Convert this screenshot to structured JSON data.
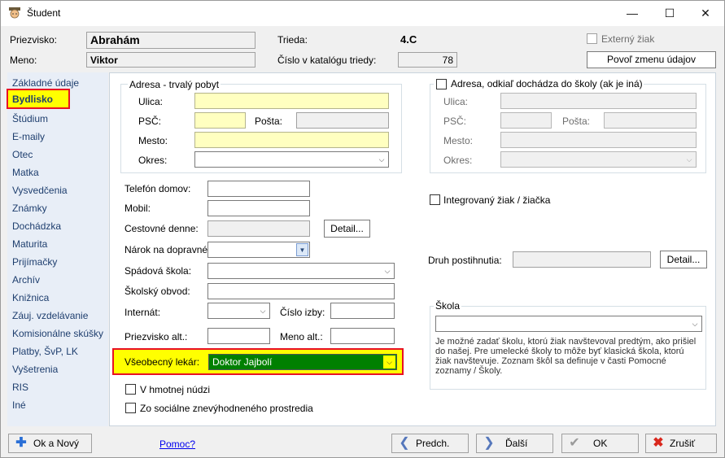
{
  "window": {
    "title": "Študent",
    "minimize": "—",
    "maximize": "☐",
    "close": "✕"
  },
  "header": {
    "surname_label": "Priezvisko:",
    "surname": "Abrahám",
    "name_label": "Meno:",
    "name": "Viktor",
    "class_label": "Trieda:",
    "class_value": "4.C",
    "catalog_label": "Číslo v katalógu triedy:",
    "catalog_value": "78",
    "external_label": "Externý žiak",
    "allow_change_label": "Povoľ zmenu údajov"
  },
  "sidebar": {
    "items": [
      {
        "label": "Základné údaje"
      },
      {
        "label": "Bydlisko",
        "selected": true
      },
      {
        "label": "Štúdium"
      },
      {
        "label": "E-maily"
      },
      {
        "label": "Otec"
      },
      {
        "label": "Matka"
      },
      {
        "label": "Vysvedčenia"
      },
      {
        "label": "Známky"
      },
      {
        "label": "Dochádzka"
      },
      {
        "label": "Maturita"
      },
      {
        "label": "Prijímačky"
      },
      {
        "label": "Archív"
      },
      {
        "label": "Knižnica"
      },
      {
        "label": "Záuj. vzdelávanie"
      },
      {
        "label": "Komisionálne skúšky"
      },
      {
        "label": "Platby, ŠvP, LK"
      },
      {
        "label": "Vyšetrenia"
      },
      {
        "label": "RIS"
      },
      {
        "label": "Iné"
      }
    ]
  },
  "address": {
    "title": "Adresa - trvalý pobyt",
    "street_label": "Ulica:",
    "street": "",
    "zip_label": "PSČ:",
    "zip": "",
    "post_label": "Pošta:",
    "post": "",
    "city_label": "Mesto:",
    "city": "",
    "district_label": "Okres:",
    "district": ""
  },
  "address2": {
    "title": "Adresa, odkiaľ dochádza do školy (ak je iná)",
    "street_label": "Ulica:",
    "zip_label": "PSČ:",
    "post_label": "Pošta:",
    "city_label": "Mesto:",
    "district_label": "Okres:"
  },
  "contact": {
    "home_phone_label": "Telefón domov:",
    "mobile_label": "Mobil:",
    "travel_label": "Cestovné denne:",
    "detail_label": "Detail...",
    "transport_label": "Nárok na dopravné:",
    "catchment_label": "Spádová škola:",
    "district_label": "Školský obvod:",
    "boarding_label": "Internát:",
    "room_label": "Číslo izby:",
    "surname_alt_label": "Priezvisko alt.:",
    "name_alt_label": "Meno alt.:",
    "doctor_label": "Všeobecný lekár:",
    "doctor_value": "Doktor Jajbolí",
    "need_label": "V hmotnej núdzi",
    "social_label": "Zo sociálne znevýhodneného prostredia"
  },
  "right": {
    "integrated_label": "Integrovaný žiak / žiačka",
    "disability_label": "Druh postihnutia:",
    "detail_label": "Detail...",
    "school_title": "Škola",
    "school_note": "Je možné zadať školu, ktorú žiak navštevoval predtým, ako prišiel do našej. Pre umelecké školy to môže byť klasická škola, ktorú žiak navštevuje. Zoznam škôl sa definuje v časti Pomocné zoznamy / Školy."
  },
  "footer": {
    "ok_new": "Ok a Nový",
    "help": "Pomoc?",
    "prev": "Predch.",
    "next": "Ďalší",
    "ok": "OK",
    "cancel": "Zrušiť"
  },
  "colors": {
    "highlight": "#e81123",
    "doctor_bg": "#008000",
    "field_yellow": "#ffffc0",
    "selected_bg": "#ffff00"
  }
}
